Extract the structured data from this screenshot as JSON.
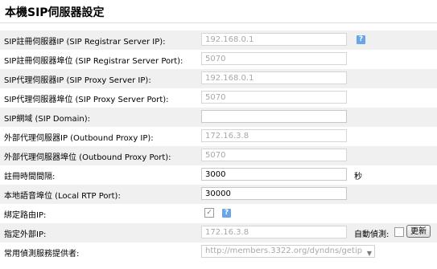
{
  "page": {
    "title": "本機SIP伺服器設定"
  },
  "rows": [
    {
      "label": "SIP註冊伺服器IP (SIP Registrar Server IP):",
      "value": "192.168.0.1",
      "disabled": true,
      "help": "?"
    },
    {
      "label": "SIP註冊伺服器埠位 (SIP Registrar Server Port):",
      "value": "5070",
      "disabled": true
    },
    {
      "label": "SIP代理伺服器IP (SIP Proxy Server IP):",
      "value": "192.168.0.1",
      "disabled": true
    },
    {
      "label": "SIP代理伺服器埠位 (SIP Proxy Server Port):",
      "value": "5070",
      "disabled": true
    },
    {
      "label": "SIP網域 (SIP Domain):",
      "value": "",
      "disabled": false
    },
    {
      "label": "外部代理伺服器IP (Outbound Proxy IP):",
      "value": "172.16.3.8",
      "disabled": true
    },
    {
      "label": "外部代理伺服器埠位 (Outbound Proxy Port):",
      "value": "5070",
      "disabled": true
    },
    {
      "label": "註冊時間間隔:",
      "value": "3000",
      "disabled": false,
      "unit": "秒"
    },
    {
      "label": "本地語音埠位 (Local RTP Port):",
      "value": "30000",
      "disabled": false
    },
    {
      "label": "綁定路由IP:",
      "checked": true,
      "help": "?"
    },
    {
      "label": "指定外部IP:",
      "value": "172.16.3.8",
      "disabled": true,
      "auto_detect_label": "自動偵測:",
      "refresh_label": "更新"
    },
    {
      "label": "常用偵測服務提供者:",
      "selected": "http://members.3322.org/dyndns/getip"
    }
  ],
  "colors": {
    "help_badge": "#6aa5e8",
    "row_alt_bg": "#f0f0f0",
    "disabled_text": "#a8a8a8"
  }
}
